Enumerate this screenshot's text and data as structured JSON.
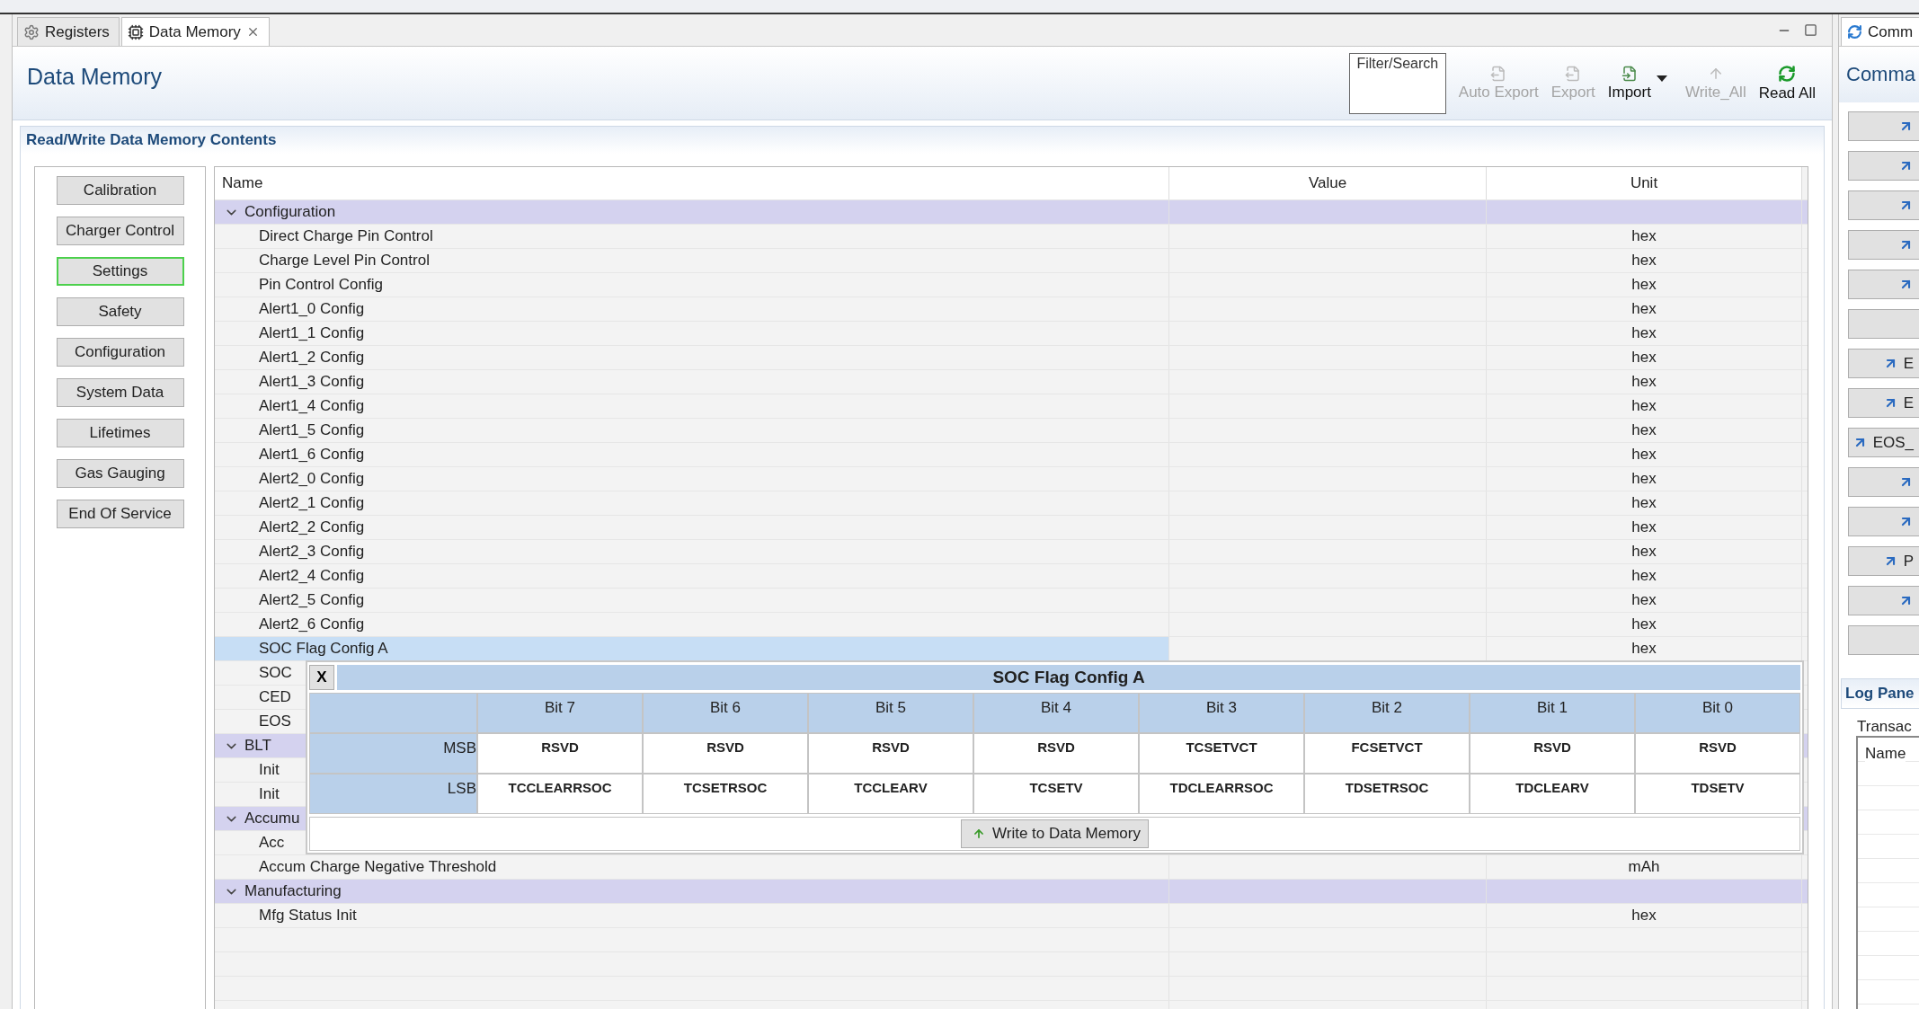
{
  "editor_tabs": [
    {
      "label": "Registers",
      "kind": "gear",
      "selected": false
    },
    {
      "label": "Data Memory",
      "kind": "chip",
      "selected": true,
      "closable": true
    }
  ],
  "page_title": "Data Memory",
  "toolbar": {
    "filter_placeholder": "Filter/Search",
    "actions": [
      {
        "label": "Auto Export",
        "kind": "export",
        "disabled": true
      },
      {
        "label": "Export",
        "kind": "export",
        "disabled": true
      },
      {
        "label": "Import",
        "kind": "import",
        "disabled": false,
        "dropdown": true
      },
      {
        "label": "Write_All",
        "kind": "upload",
        "disabled": true
      },
      {
        "label": "Read All",
        "kind": "refresh",
        "disabled": false
      }
    ]
  },
  "section_title": "Read/Write Data Memory Contents",
  "categories": [
    {
      "label": "Calibration",
      "selected": false
    },
    {
      "label": "Charger Control",
      "selected": false
    },
    {
      "label": "Settings",
      "selected": true
    },
    {
      "label": "Safety",
      "selected": false
    },
    {
      "label": "Configuration",
      "selected": false
    },
    {
      "label": "System Data",
      "selected": false
    },
    {
      "label": "Lifetimes",
      "selected": false
    },
    {
      "label": "Gas Gauging",
      "selected": false
    },
    {
      "label": "End Of Service",
      "selected": false
    }
  ],
  "table": {
    "columns": [
      "Name",
      "Value",
      "Unit"
    ],
    "groups": [
      {
        "name": "Configuration",
        "expanded": true,
        "children": [
          {
            "name": "Direct Charge Pin Control",
            "unit": "hex",
            "selected": false
          },
          {
            "name": "Charge Level Pin Control",
            "unit": "hex",
            "selected": false
          },
          {
            "name": "Pin Control Config",
            "unit": "hex",
            "selected": false
          },
          {
            "name": "Alert1_0 Config",
            "unit": "hex",
            "selected": false
          },
          {
            "name": "Alert1_1 Config",
            "unit": "hex",
            "selected": false
          },
          {
            "name": "Alert1_2 Config",
            "unit": "hex",
            "selected": false
          },
          {
            "name": "Alert1_3 Config",
            "unit": "hex",
            "selected": false
          },
          {
            "name": "Alert1_4 Config",
            "unit": "hex",
            "selected": false
          },
          {
            "name": "Alert1_5 Config",
            "unit": "hex",
            "selected": false
          },
          {
            "name": "Alert1_6 Config",
            "unit": "hex",
            "selected": false
          },
          {
            "name": "Alert2_0 Config",
            "unit": "hex",
            "selected": false
          },
          {
            "name": "Alert2_1 Config",
            "unit": "hex",
            "selected": false
          },
          {
            "name": "Alert2_2 Config",
            "unit": "hex",
            "selected": false
          },
          {
            "name": "Alert2_3 Config",
            "unit": "hex",
            "selected": false
          },
          {
            "name": "Alert2_4 Config",
            "unit": "hex",
            "selected": false
          },
          {
            "name": "Alert2_5 Config",
            "unit": "hex",
            "selected": false
          },
          {
            "name": "Alert2_6 Config",
            "unit": "hex",
            "selected": false
          },
          {
            "name": "SOC Flag Config A",
            "unit": "hex",
            "selected": true
          },
          {
            "name": "SOC",
            "selected": false
          },
          {
            "name": "CED",
            "selected": false
          },
          {
            "name": "EOS",
            "selected": false
          }
        ]
      },
      {
        "name": "BLT",
        "expanded": true,
        "children": [
          {
            "name": "Init",
            "selected": false
          },
          {
            "name": "Init",
            "selected": false
          }
        ]
      },
      {
        "name": "Accumu",
        "expanded": true,
        "children": [
          {
            "name": "Acc",
            "selected": false
          },
          {
            "name": "Accum Charge Negative Threshold",
            "unit": "mAh",
            "selected": false
          }
        ]
      },
      {
        "name": "Manufacturing",
        "expanded": true,
        "children": [
          {
            "name": "Mfg Status Init",
            "unit": "hex",
            "selected": false
          }
        ]
      }
    ]
  },
  "popup": {
    "close": "X",
    "title": "SOC Flag Config A",
    "bits": [
      "Bit 7",
      "Bit 6",
      "Bit 5",
      "Bit 4",
      "Bit 3",
      "Bit 2",
      "Bit 1",
      "Bit 0"
    ],
    "rows": [
      {
        "label": "MSB",
        "bits": [
          "RSVD",
          "RSVD",
          "RSVD",
          "RSVD",
          "TCSETVCT",
          "FCSETVCT",
          "RSVD",
          "RSVD"
        ]
      },
      {
        "label": "LSB",
        "bits": [
          "TCCLEARRSOC",
          "TCSETRSOC",
          "TCCLEARV",
          "TCSETV",
          "TDCLEARRSOC",
          "TDSETRSOC",
          "TDCLEARV",
          "TDSETV"
        ]
      }
    ],
    "button": "Write to Data Memory"
  },
  "side_panel": {
    "tab": "Comm",
    "title": "Comma",
    "buttons": [
      {
        "kind": "arrow"
      },
      {
        "kind": "arrow"
      },
      {
        "kind": "arrow"
      },
      {
        "kind": "arrow"
      },
      {
        "kind": "arrow"
      },
      {
        "kind": "blank"
      },
      {
        "kind": "arrow",
        "label": "E"
      },
      {
        "kind": "arrow",
        "label": "E"
      },
      {
        "kind": "arrow",
        "label": "EOS_"
      },
      {
        "kind": "arrow"
      },
      {
        "kind": "arrow"
      },
      {
        "kind": "arrow",
        "label": "P"
      },
      {
        "kind": "arrow"
      },
      {
        "kind": "blank"
      }
    ]
  },
  "log_panel": {
    "title": "Log Pane",
    "group": "Transac",
    "column": "Name"
  }
}
